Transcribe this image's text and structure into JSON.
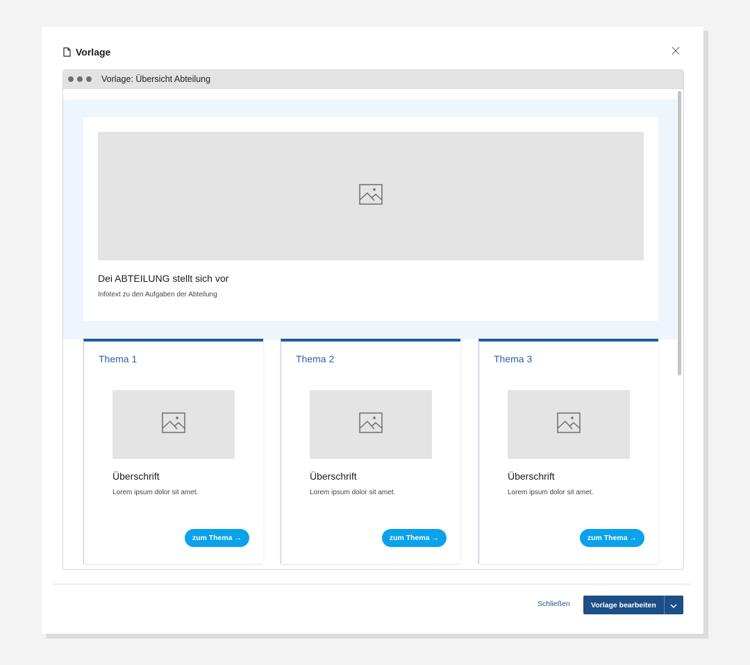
{
  "modal": {
    "title": "Vorlage",
    "icon": "document-icon",
    "close_icon": "close-icon"
  },
  "browser": {
    "title": "Vorlage: Übersicht Abteilung"
  },
  "hero": {
    "title": "Dei ABTEILUNG stellt sich vor",
    "text": "Infotext zu den Aufgaben der Abteilung"
  },
  "topics": [
    {
      "title": "Thema 1",
      "heading": "Überschrift",
      "text": "Lorem ipsum dolor sit amet.",
      "button": "zum Thema →"
    },
    {
      "title": "Thema 2",
      "heading": "Überschrift",
      "text": "Lorem ipsum dolor sit amet.",
      "button": "zum Thema →"
    },
    {
      "title": "Thema 3",
      "heading": "Überschrift",
      "text": "Lorem ipsum dolor sit amet.",
      "button": "zum Thema →"
    }
  ],
  "footer": {
    "close_label": "Schließen",
    "primary_label": "Vorlage bearbeiten"
  },
  "colors": {
    "accent": "#1f5aa5",
    "button_cyan": "#0aa2ea",
    "primary_dark": "#1b4f86",
    "hero_band": "#eef6fc"
  }
}
